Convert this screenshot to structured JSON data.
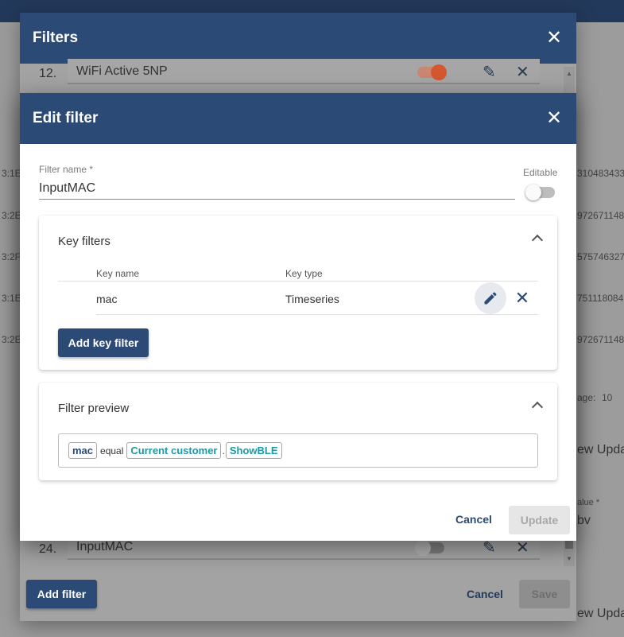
{
  "background": {
    "left_column": [
      "3:1E",
      "3:2E",
      "3:2F",
      "3:1E",
      "3:2E"
    ],
    "right_column": [
      "310483433",
      "972671148",
      "575746327",
      "751118084",
      "972671148"
    ],
    "page_size_label": "age:",
    "page_size_value": "10",
    "right_panel_title_1": "ew Upda",
    "right_panel_value_label": "alue *",
    "right_panel_value": "bv",
    "right_panel_title_2": "ew Upda"
  },
  "filters_dialog": {
    "title": "Filters",
    "rows": [
      {
        "number": "12.",
        "name": "WiFi Active 5NP",
        "enabled": true
      },
      {
        "number": "24.",
        "name": "InputMAC",
        "enabled": false
      }
    ],
    "add_filter_label": "Add filter",
    "cancel_label": "Cancel",
    "save_label": "Save"
  },
  "edit_dialog": {
    "title": "Edit filter",
    "filter_name_label": "Filter name *",
    "filter_name_value": "InputMAC",
    "editable_label": "Editable",
    "editable": false,
    "key_filters": {
      "title": "Key filters",
      "columns": [
        "Key name",
        "Key type"
      ],
      "rows": [
        {
          "key_name": "mac",
          "key_type": "Timeseries"
        }
      ],
      "add_label": "Add key filter"
    },
    "preview": {
      "title": "Filter preview",
      "key": "mac",
      "operation": "equal",
      "value_source": "Current customer",
      "separator": ".",
      "attribute": "ShowBLE"
    },
    "cancel_label": "Cancel",
    "update_label": "Update"
  },
  "colors": {
    "primary": "#2b4a75",
    "toggle_on": "#e8592f",
    "preview_value": "#1a9aa6"
  }
}
